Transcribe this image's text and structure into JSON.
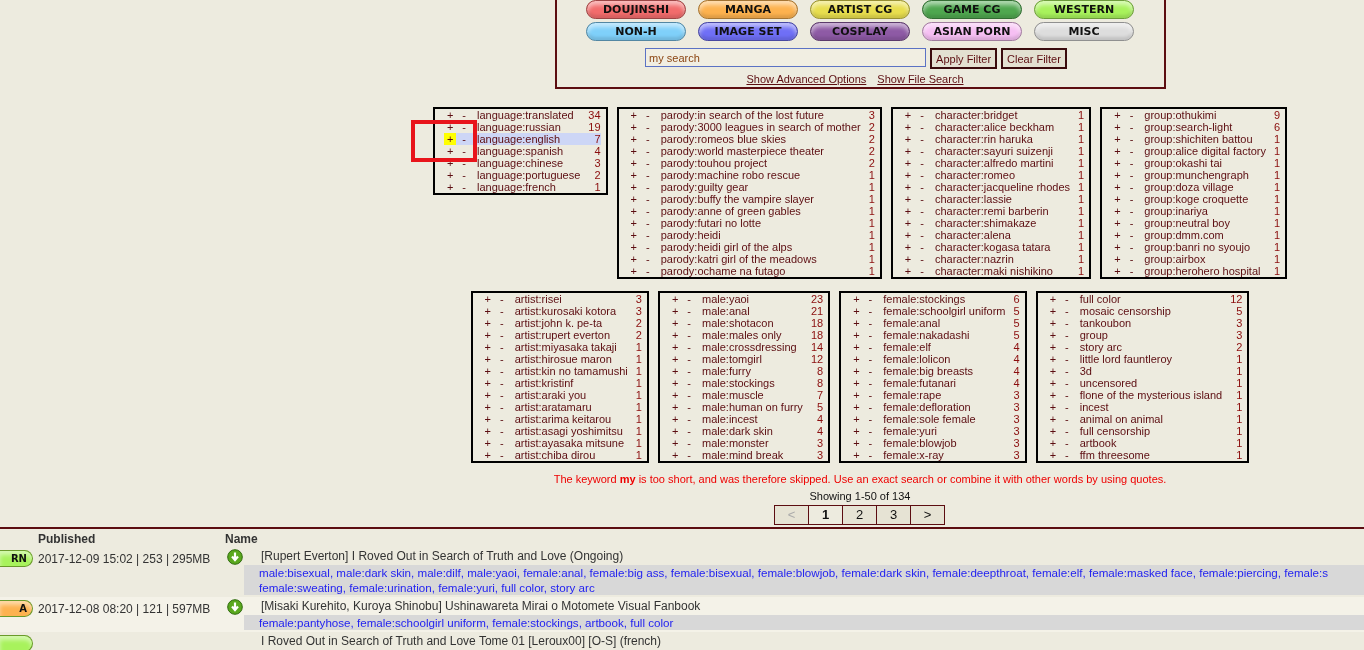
{
  "categories": [
    {
      "label": "DOUJINSHI",
      "color": "#f26c6c"
    },
    {
      "label": "MANGA",
      "color": "#fdb24f"
    },
    {
      "label": "ARTIST CG",
      "color": "#e8de4e"
    },
    {
      "label": "GAME CG",
      "color": "#4fa74f"
    },
    {
      "label": "WESTERN",
      "color": "#a8f25c"
    },
    {
      "label": "NON-H",
      "color": "#7fd0fa"
    },
    {
      "label": "IMAGE SET",
      "color": "#6f6ff6"
    },
    {
      "label": "COSPLAY",
      "color": "#8e5aa5"
    },
    {
      "label": "ASIAN PORN",
      "color": "#f6bff3"
    },
    {
      "label": "MISC",
      "color": "#dddddd"
    }
  ],
  "search": {
    "value": "my search"
  },
  "buttons": [
    "Apply Filter",
    "Clear Filter"
  ],
  "links": [
    "Show Advanced Options",
    "Show File Search"
  ],
  "tag_groups": [
    {
      "tables": [
        {
          "marked": true,
          "rows": [
            {
              "add": "+",
              "exclude": "-",
              "tag": "language:translated",
              "count": "34",
              "highlighted": false
            },
            {
              "add": "+",
              "exclude": "-",
              "tag": "language:russian",
              "count": "19",
              "highlighted": false
            },
            {
              "add": "+",
              "exclude": "-",
              "tag": "language:english",
              "count": "7",
              "highlighted": true
            },
            {
              "add": "+",
              "exclude": "-",
              "tag": "language:spanish",
              "count": "4",
              "highlighted": false
            },
            {
              "add": "+",
              "exclude": "-",
              "tag": "language:chinese",
              "count": "3",
              "highlighted": false
            },
            {
              "add": "+",
              "exclude": "-",
              "tag": "language:portuguese",
              "count": "2",
              "highlighted": false
            },
            {
              "add": "+",
              "exclude": "-",
              "tag": "language:french",
              "count": "1",
              "highlighted": false
            }
          ]
        },
        {
          "rows": [
            {
              "add": "+",
              "exclude": "-",
              "tag": "parody:in search of the lost future",
              "count": "3"
            },
            {
              "add": "+",
              "exclude": "-",
              "tag": "parody:3000 leagues in search of mother",
              "count": "2"
            },
            {
              "add": "+",
              "exclude": "-",
              "tag": "parody:romeos blue skies",
              "count": "2"
            },
            {
              "add": "+",
              "exclude": "-",
              "tag": "parody:world masterpiece theater",
              "count": "2"
            },
            {
              "add": "+",
              "exclude": "-",
              "tag": "parody:touhou project",
              "count": "2"
            },
            {
              "add": "+",
              "exclude": "-",
              "tag": "parody:machine robo rescue",
              "count": "1"
            },
            {
              "add": "+",
              "exclude": "-",
              "tag": "parody:guilty gear",
              "count": "1"
            },
            {
              "add": "+",
              "exclude": "-",
              "tag": "parody:buffy the vampire slayer",
              "count": "1"
            },
            {
              "add": "+",
              "exclude": "-",
              "tag": "parody:anne of green gables",
              "count": "1"
            },
            {
              "add": "+",
              "exclude": "-",
              "tag": "parody:futari no lotte",
              "count": "1"
            },
            {
              "add": "+",
              "exclude": "-",
              "tag": "parody:heidi",
              "count": "1"
            },
            {
              "add": "+",
              "exclude": "-",
              "tag": "parody:heidi girl of the alps",
              "count": "1"
            },
            {
              "add": "+",
              "exclude": "-",
              "tag": "parody:katri girl of the meadows",
              "count": "1"
            },
            {
              "add": "+",
              "exclude": "-",
              "tag": "parody:ochame na futago",
              "count": "1"
            }
          ]
        },
        {
          "rows": [
            {
              "add": "+",
              "exclude": "-",
              "tag": "character:bridget",
              "count": "1"
            },
            {
              "add": "+",
              "exclude": "-",
              "tag": "character:alice beckham",
              "count": "1"
            },
            {
              "add": "+",
              "exclude": "-",
              "tag": "character:rin haruka",
              "count": "1"
            },
            {
              "add": "+",
              "exclude": "-",
              "tag": "character:sayuri suizenji",
              "count": "1"
            },
            {
              "add": "+",
              "exclude": "-",
              "tag": "character:alfredo martini",
              "count": "1"
            },
            {
              "add": "+",
              "exclude": "-",
              "tag": "character:romeo",
              "count": "1"
            },
            {
              "add": "+",
              "exclude": "-",
              "tag": "character:jacqueline rhodes",
              "count": "1"
            },
            {
              "add": "+",
              "exclude": "-",
              "tag": "character:lassie",
              "count": "1"
            },
            {
              "add": "+",
              "exclude": "-",
              "tag": "character:remi barberin",
              "count": "1"
            },
            {
              "add": "+",
              "exclude": "-",
              "tag": "character:shimakaze",
              "count": "1"
            },
            {
              "add": "+",
              "exclude": "-",
              "tag": "character:alena",
              "count": "1"
            },
            {
              "add": "+",
              "exclude": "-",
              "tag": "character:kogasa tatara",
              "count": "1"
            },
            {
              "add": "+",
              "exclude": "-",
              "tag": "character:nazrin",
              "count": "1"
            },
            {
              "add": "+",
              "exclude": "-",
              "tag": "character:maki nishikino",
              "count": "1"
            }
          ]
        },
        {
          "rows": [
            {
              "add": "+",
              "exclude": "-",
              "tag": "group:othukimi",
              "count": "9"
            },
            {
              "add": "+",
              "exclude": "-",
              "tag": "group:search-light",
              "count": "6"
            },
            {
              "add": "+",
              "exclude": "-",
              "tag": "group:shichiten battou",
              "count": "1"
            },
            {
              "add": "+",
              "exclude": "-",
              "tag": "group:alice digital factory",
              "count": "1"
            },
            {
              "add": "+",
              "exclude": "-",
              "tag": "group:okashi tai",
              "count": "1"
            },
            {
              "add": "+",
              "exclude": "-",
              "tag": "group:munchengraph",
              "count": "1"
            },
            {
              "add": "+",
              "exclude": "-",
              "tag": "group:doza village",
              "count": "1"
            },
            {
              "add": "+",
              "exclude": "-",
              "tag": "group:koge croquette",
              "count": "1"
            },
            {
              "add": "+",
              "exclude": "-",
              "tag": "group:inariya",
              "count": "1"
            },
            {
              "add": "+",
              "exclude": "-",
              "tag": "group:neutral boy",
              "count": "1"
            },
            {
              "add": "+",
              "exclude": "-",
              "tag": "group:dmm.com",
              "count": "1"
            },
            {
              "add": "+",
              "exclude": "-",
              "tag": "group:banri no syoujo",
              "count": "1"
            },
            {
              "add": "+",
              "exclude": "-",
              "tag": "group:airbox",
              "count": "1"
            },
            {
              "add": "+",
              "exclude": "-",
              "tag": "group:herohero hospital",
              "count": "1"
            }
          ]
        }
      ]
    },
    {
      "tables": [
        {
          "rows": [
            {
              "add": "+",
              "exclude": "-",
              "tag": "artist:risei",
              "count": "3"
            },
            {
              "add": "+",
              "exclude": "-",
              "tag": "artist:kurosaki kotora",
              "count": "3"
            },
            {
              "add": "+",
              "exclude": "-",
              "tag": "artist:john k. pe-ta",
              "count": "2"
            },
            {
              "add": "+",
              "exclude": "-",
              "tag": "artist:rupert everton",
              "count": "2"
            },
            {
              "add": "+",
              "exclude": "-",
              "tag": "artist:miyasaka takaji",
              "count": "1"
            },
            {
              "add": "+",
              "exclude": "-",
              "tag": "artist:hirosue maron",
              "count": "1"
            },
            {
              "add": "+",
              "exclude": "-",
              "tag": "artist:kin no tamamushi",
              "count": "1"
            },
            {
              "add": "+",
              "exclude": "-",
              "tag": "artist:kristinf",
              "count": "1"
            },
            {
              "add": "+",
              "exclude": "-",
              "tag": "artist:araki you",
              "count": "1"
            },
            {
              "add": "+",
              "exclude": "-",
              "tag": "artist:aratamaru",
              "count": "1"
            },
            {
              "add": "+",
              "exclude": "-",
              "tag": "artist:arima keitarou",
              "count": "1"
            },
            {
              "add": "+",
              "exclude": "-",
              "tag": "artist:asagi yoshimitsu",
              "count": "1"
            },
            {
              "add": "+",
              "exclude": "-",
              "tag": "artist:ayasaka mitsune",
              "count": "1"
            },
            {
              "add": "+",
              "exclude": "-",
              "tag": "artist:chiba dirou",
              "count": "1"
            }
          ]
        },
        {
          "rows": [
            {
              "add": "+",
              "exclude": "-",
              "tag": "male:yaoi",
              "count": "23"
            },
            {
              "add": "+",
              "exclude": "-",
              "tag": "male:anal",
              "count": "21"
            },
            {
              "add": "+",
              "exclude": "-",
              "tag": "male:shotacon",
              "count": "18"
            },
            {
              "add": "+",
              "exclude": "-",
              "tag": "male:males only",
              "count": "18"
            },
            {
              "add": "+",
              "exclude": "-",
              "tag": "male:crossdressing",
              "count": "14"
            },
            {
              "add": "+",
              "exclude": "-",
              "tag": "male:tomgirl",
              "count": "12"
            },
            {
              "add": "+",
              "exclude": "-",
              "tag": "male:furry",
              "count": "8"
            },
            {
              "add": "+",
              "exclude": "-",
              "tag": "male:stockings",
              "count": "8"
            },
            {
              "add": "+",
              "exclude": "-",
              "tag": "male:muscle",
              "count": "7"
            },
            {
              "add": "+",
              "exclude": "-",
              "tag": "male:human on furry",
              "count": "5"
            },
            {
              "add": "+",
              "exclude": "-",
              "tag": "male:incest",
              "count": "4"
            },
            {
              "add": "+",
              "exclude": "-",
              "tag": "male:dark skin",
              "count": "4"
            },
            {
              "add": "+",
              "exclude": "-",
              "tag": "male:monster",
              "count": "3"
            },
            {
              "add": "+",
              "exclude": "-",
              "tag": "male:mind break",
              "count": "3"
            }
          ]
        },
        {
          "rows": [
            {
              "add": "+",
              "exclude": "-",
              "tag": "female:stockings",
              "count": "6"
            },
            {
              "add": "+",
              "exclude": "-",
              "tag": "female:schoolgirl uniform",
              "count": "5"
            },
            {
              "add": "+",
              "exclude": "-",
              "tag": "female:anal",
              "count": "5"
            },
            {
              "add": "+",
              "exclude": "-",
              "tag": "female:nakadashi",
              "count": "5"
            },
            {
              "add": "+",
              "exclude": "-",
              "tag": "female:elf",
              "count": "4"
            },
            {
              "add": "+",
              "exclude": "-",
              "tag": "female:lolicon",
              "count": "4"
            },
            {
              "add": "+",
              "exclude": "-",
              "tag": "female:big breasts",
              "count": "4"
            },
            {
              "add": "+",
              "exclude": "-",
              "tag": "female:futanari",
              "count": "4"
            },
            {
              "add": "+",
              "exclude": "-",
              "tag": "female:rape",
              "count": "3"
            },
            {
              "add": "+",
              "exclude": "-",
              "tag": "female:defloration",
              "count": "3"
            },
            {
              "add": "+",
              "exclude": "-",
              "tag": "female:sole female",
              "count": "3"
            },
            {
              "add": "+",
              "exclude": "-",
              "tag": "female:yuri",
              "count": "3"
            },
            {
              "add": "+",
              "exclude": "-",
              "tag": "female:blowjob",
              "count": "3"
            },
            {
              "add": "+",
              "exclude": "-",
              "tag": "female:x-ray",
              "count": "3"
            }
          ]
        },
        {
          "rows": [
            {
              "add": "+",
              "exclude": "-",
              "tag": "full color",
              "count": "12"
            },
            {
              "add": "+",
              "exclude": "-",
              "tag": "mosaic censorship",
              "count": "5"
            },
            {
              "add": "+",
              "exclude": "-",
              "tag": "tankoubon",
              "count": "3"
            },
            {
              "add": "+",
              "exclude": "-",
              "tag": "group",
              "count": "3"
            },
            {
              "add": "+",
              "exclude": "-",
              "tag": "story arc",
              "count": "2"
            },
            {
              "add": "+",
              "exclude": "-",
              "tag": "little lord fauntleroy",
              "count": "1"
            },
            {
              "add": "+",
              "exclude": "-",
              "tag": "3d",
              "count": "1"
            },
            {
              "add": "+",
              "exclude": "-",
              "tag": "uncensored",
              "count": "1"
            },
            {
              "add": "+",
              "exclude": "-",
              "tag": "flone of the mysterious island",
              "count": "1"
            },
            {
              "add": "+",
              "exclude": "-",
              "tag": "incest",
              "count": "1"
            },
            {
              "add": "+",
              "exclude": "-",
              "tag": "animal on animal",
              "count": "1"
            },
            {
              "add": "+",
              "exclude": "-",
              "tag": "full censorship",
              "count": "1"
            },
            {
              "add": "+",
              "exclude": "-",
              "tag": "artbook",
              "count": "1"
            },
            {
              "add": "+",
              "exclude": "-",
              "tag": "ffm threesome",
              "count": "1"
            }
          ]
        }
      ]
    }
  ],
  "notice": "The keyword **my** is too short, and was therefore skipped. Use an exact search or combine it with other words by using quotes.",
  "showing": "Showing 1-50 of 134",
  "pages": [
    {
      "label": "<",
      "selected": false,
      "disabled": true
    },
    {
      "label": "1",
      "selected": true,
      "disabled": false
    },
    {
      "label": "2",
      "selected": false,
      "disabled": false
    },
    {
      "label": "3",
      "selected": false,
      "disabled": false
    },
    {
      "label": ">",
      "selected": false,
      "disabled": false
    }
  ],
  "results": {
    "columns": [
      "Published",
      "Name"
    ],
    "rows": [
      {
        "category": "RN",
        "color": "#a8f25c",
        "published": "2017-12-09 15:02 | 253 | 295MB",
        "download": true,
        "title": "[Rupert Everton] I Roved Out in Search of Truth and Love (Ongoing)",
        "tags": [
          "male:bisexual, male:dark skin, male:dilf, male:yaoi, female:anal, female:big ass, female:bisexual, female:blowjob, female:dark skin, female:deepthroat, female:elf, female:masked face, female:piercing, female:s",
          "female:sweating, female:urination, female:yuri, full color, story arc"
        ]
      },
      {
        "category": "A",
        "color": "#fdb24f",
        "published": "2017-12-08 08:20 | 121 | 597MB",
        "download": true,
        "title": "[Misaki Kurehito, Kuroya Shinobu] Ushinawareta Mirai o Motomete Visual Fanbook",
        "tags": [
          "female:pantyhose, female:schoolgirl uniform, female:stockings, artbook, full color"
        ]
      },
      {
        "color": "#a8f25c",
        "download": false,
        "title": "I Roved Out in Search of Truth and Love Tome 01 [Leroux00] [O-S] (french)"
      }
    ]
  }
}
